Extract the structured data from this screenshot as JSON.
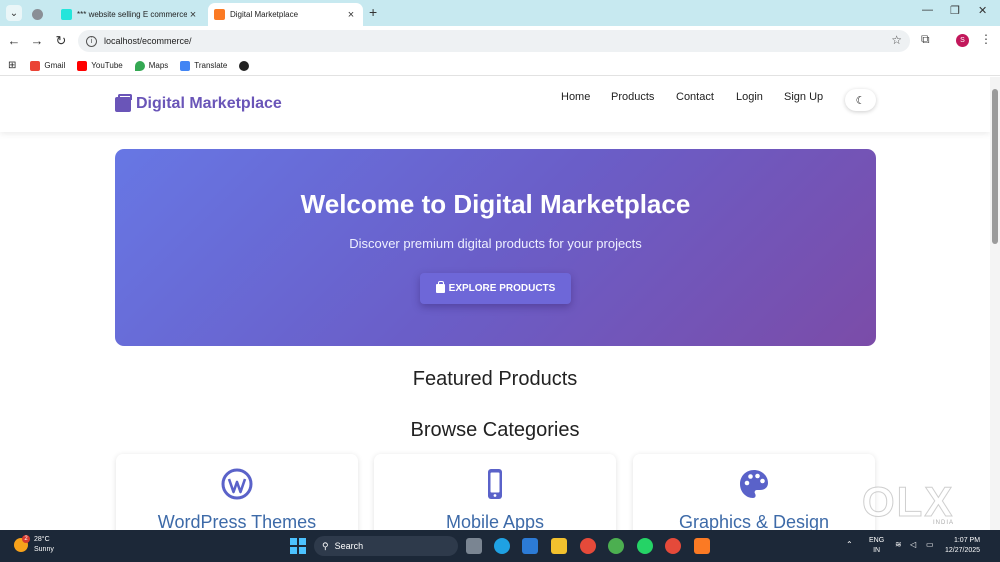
{
  "browser": {
    "tabs": [
      {
        "title": ""
      },
      {
        "title": "*** website selling E commerce"
      },
      {
        "title": "Digital Marketplace"
      }
    ],
    "new_tab": "+",
    "window_controls": {
      "minimize": "—",
      "maximize": "❐",
      "close": "✕"
    },
    "address": "localhost/ecommerce/",
    "profile_initial": "S",
    "bookmarks": [
      {
        "label": "Gmail",
        "color": "#ea4335"
      },
      {
        "label": "YouTube",
        "color": "#ff0000"
      },
      {
        "label": "Maps",
        "color": "#34a853"
      },
      {
        "label": "Translate",
        "color": "#4285f4"
      }
    ]
  },
  "site": {
    "brand": "Digital Marketplace",
    "nav": [
      "Home",
      "Products",
      "Contact",
      "Login",
      "Sign Up"
    ],
    "theme_toggle_icon": "moon-icon",
    "hero": {
      "title": "Welcome to Digital Marketplace",
      "subtitle": "Discover premium digital products for your projects",
      "button": "EXPLORE PRODUCTS"
    },
    "featured_title": "Featured Products",
    "categories_title": "Browse Categories",
    "categories": [
      {
        "title": "WordPress Themes",
        "icon": "wordpress-icon"
      },
      {
        "title": "Mobile Apps",
        "icon": "mobile-icon"
      },
      {
        "title": "Graphics & Design",
        "icon": "palette-icon"
      }
    ],
    "accent": "#6a55b8",
    "category_color": "#3d6aa8"
  },
  "watermark": {
    "text": "OLX",
    "sub": "INDIA"
  },
  "taskbar": {
    "weather_temp": "28°C",
    "weather_desc": "Sunny",
    "weather_badge": "2",
    "search": "Search",
    "lang_line1": "ENG",
    "lang_line2": "IN",
    "time": "1:07 PM",
    "date": "12/27/2025"
  }
}
